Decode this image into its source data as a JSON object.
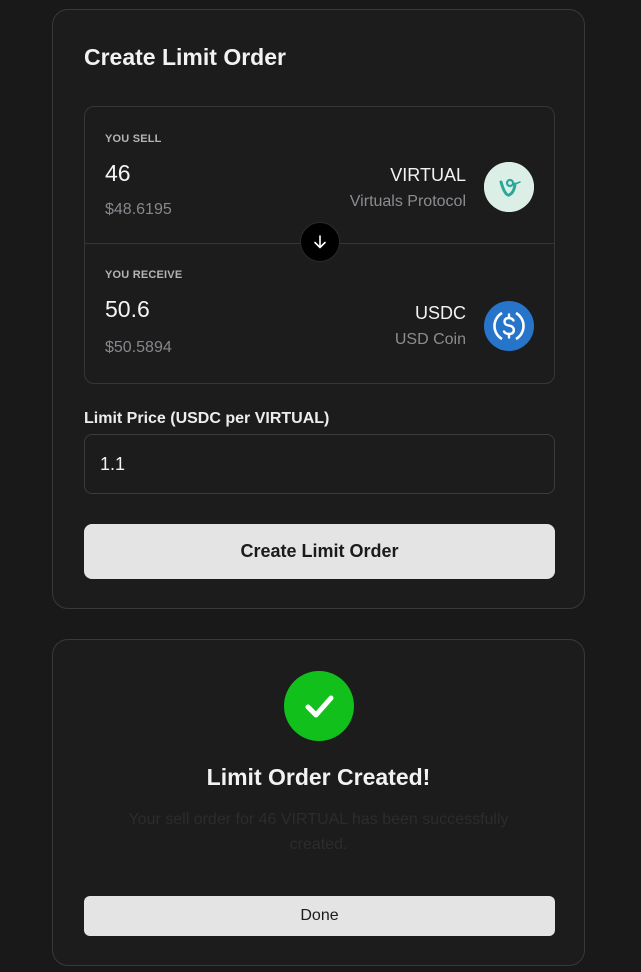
{
  "order_card": {
    "title": "Create Limit Order",
    "sell": {
      "label": "YOU SELL",
      "amount": "46",
      "usd_value": "$48.6195",
      "token_symbol": "VIRTUAL",
      "token_name": "Virtuals Protocol",
      "logo_icon": "virtual-token-icon"
    },
    "receive": {
      "label": "YOU RECEIVE",
      "amount": "50.6",
      "usd_value": "$50.5894",
      "token_symbol": "USDC",
      "token_name": "USD Coin",
      "logo_icon": "usdc-token-icon"
    },
    "swap_direction_icon": "arrow-down-icon",
    "limit_price_label": "Limit Price (USDC per VIRTUAL)",
    "limit_price_value": "1.1",
    "submit_label": "Create Limit Order"
  },
  "success_card": {
    "icon": "checkmark-icon",
    "title": "Limit Order Created!",
    "message": "Your sell order for 46 VIRTUAL has been successfully created.",
    "done_label": "Done"
  },
  "colors": {
    "background": "#19191a",
    "success_green": "#12c01c",
    "usdc_blue": "#2775ca",
    "button_bg": "#e4e4e4"
  }
}
